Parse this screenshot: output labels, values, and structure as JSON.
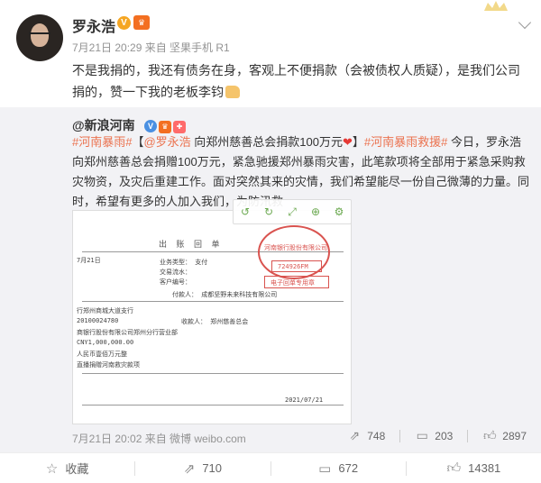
{
  "post": {
    "username": "罗永浩",
    "v_badge": "V",
    "vip_badge": "♛",
    "meta": "7月21日 20:29 来自 坚果手机 R1",
    "text": "不是我捐的，我还有债务在身，客观上不便捐款（会被债权人质疑），是我们公司捐的，赞一下我的老板李钧",
    "colors": {
      "link": "#eb7350",
      "name": "#333333",
      "meta": "#939393"
    }
  },
  "repost": {
    "author": "@新浪河南",
    "segments": {
      "tag1": "#河南暴雨#",
      "open": "【",
      "at": "@罗永浩",
      "title": " 向郑州慈善总会捐款100万元",
      "heart": "❤",
      "close": "】",
      "tag2": "#河南暴雨救援#",
      "body": " 今日，罗永浩向郑州慈善总会捐赠100万元，紧急驰援郑州暴雨灾害，此笔款项将全部用于紧急采购救灾物资，及灾后重建工作。面对突然其来的灾情，我们希望能尽一份自己微薄的力量。同时，希望有更多的人加入我们，为防汛救"
    },
    "receipt": {
      "title": "出 账 回 单",
      "stamp_top": "河南银行股份有限公司",
      "stamp_code": "724926FM",
      "stamp_bottom": "电子回单专用章",
      "lines": [
        "7月21日",
        "业务类型：  支付",
        "交易流水：",
        "客户编号：",
        "付款人：  成都坚野未来科技有限公司",
        "行郑州商城大道支行",
        "20100024780",
        "收款人：  郑州慈善总会",
        "商银行股份有限公司郑州分行营业部",
        "CNY1,000,000.00",
        "人民币壹佰万元整",
        "直播捐赠河南救灾款项",
        "2021/07/21"
      ]
    },
    "footer_time": "7月21日 20:02 来自 微博 weibo.com",
    "actions": {
      "repost": "748",
      "comment": "203",
      "like": "2897"
    }
  },
  "bottom": {
    "favorite": "收藏",
    "repost": "710",
    "comment": "672",
    "like": "14381"
  }
}
